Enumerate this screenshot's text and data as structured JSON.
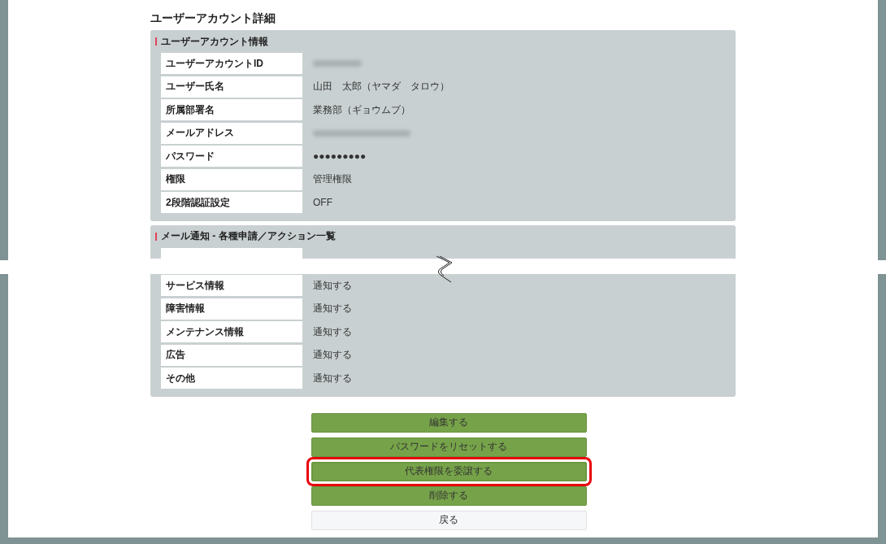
{
  "page_title": "ユーザーアカウント詳細",
  "account_section": {
    "heading": "ユーザーアカウント情報",
    "rows": [
      {
        "label": "ユーザーアカウントID",
        "kind": "redacted"
      },
      {
        "label": "ユーザー氏名",
        "kind": "text",
        "value": "山田　太郎（ヤマダ　タロウ）"
      },
      {
        "label": "所属部署名",
        "kind": "text",
        "value": "業務部（ギョウムブ）"
      },
      {
        "label": "メールアドレス",
        "kind": "redacted"
      },
      {
        "label": "パスワード",
        "kind": "text",
        "value": "●●●●●●●●●"
      },
      {
        "label": "権限",
        "kind": "text",
        "value": "管理権限"
      },
      {
        "label": "2段階認証設定",
        "kind": "text",
        "value": "OFF"
      }
    ]
  },
  "notification_section": {
    "heading": "メール通知 - 各種申請／アクション一覧",
    "rows_after_break": [
      {
        "label": "サービス情報",
        "value": "通知する"
      },
      {
        "label": "障害情報",
        "value": "通知する"
      },
      {
        "label": "メンテナンス情報",
        "value": "通知する"
      },
      {
        "label": "広告",
        "value": "通知する"
      },
      {
        "label": "その他",
        "value": "通知する"
      }
    ]
  },
  "buttons": [
    {
      "label": "編集する",
      "kind": "primary",
      "highlighted": false
    },
    {
      "label": "パスワードをリセットする",
      "kind": "primary",
      "highlighted": false
    },
    {
      "label": "代表権限を委譲する",
      "kind": "primary",
      "highlighted": true
    },
    {
      "label": "削除する",
      "kind": "primary",
      "highlighted": false
    },
    {
      "label": "戻る",
      "kind": "secondary",
      "highlighted": false
    }
  ]
}
